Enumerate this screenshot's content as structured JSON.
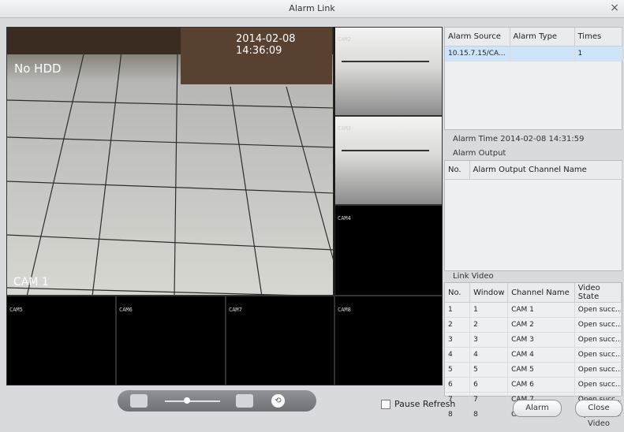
{
  "window": {
    "title": "Alarm Link"
  },
  "video": {
    "main_timestamp": "2014-02-08 14:36:09",
    "no_hdd": "No HDD",
    "main_camera": "CAM 1",
    "small_camera_labels": [
      "CAM1",
      "CAM2",
      "CAM3",
      "CAM4",
      "CAM5",
      "CAM6",
      "CAM7",
      "CAM8"
    ]
  },
  "alarm_source": {
    "columns": [
      "Alarm Source",
      "Alarm Type",
      "Times"
    ],
    "rows": [
      [
        "10.15.7.15/CA...",
        "",
        "1"
      ]
    ]
  },
  "alarm_time": {
    "label": "Alarm Time",
    "value": "2014-02-08 14:31:59"
  },
  "alarm_output": {
    "label": "Alarm Output",
    "columns": [
      "No.",
      "Alarm Output Channel Name"
    ]
  },
  "link_video": {
    "label": "Link Video",
    "columns": [
      "No.",
      "Window",
      "Channel Name",
      "Video State"
    ],
    "rows": [
      [
        "1",
        "1",
        "CAM 1",
        "Open succ..."
      ],
      [
        "2",
        "2",
        "CAM 2",
        "Open succ..."
      ],
      [
        "3",
        "3",
        "CAM 3",
        "Open succ..."
      ],
      [
        "4",
        "4",
        "CAM 4",
        "Open succ..."
      ],
      [
        "5",
        "5",
        "CAM 5",
        "Open succ..."
      ],
      [
        "6",
        "6",
        "CAM 6",
        "Open succ..."
      ],
      [
        "7",
        "7",
        "CAM 7",
        "Open succ..."
      ],
      [
        "8",
        "8",
        "CAM 8",
        "Open succ..."
      ]
    ]
  },
  "controls": {
    "pause_refresh": "Pause Refresh",
    "alarm_button": "Alarm",
    "close_video_button": "Close Video",
    "icons": [
      "split-1-icon",
      "split-16-icon",
      "lock-icon"
    ]
  },
  "colors": {
    "selected_row": "#cde4fb",
    "panel": "#eef0f2"
  }
}
